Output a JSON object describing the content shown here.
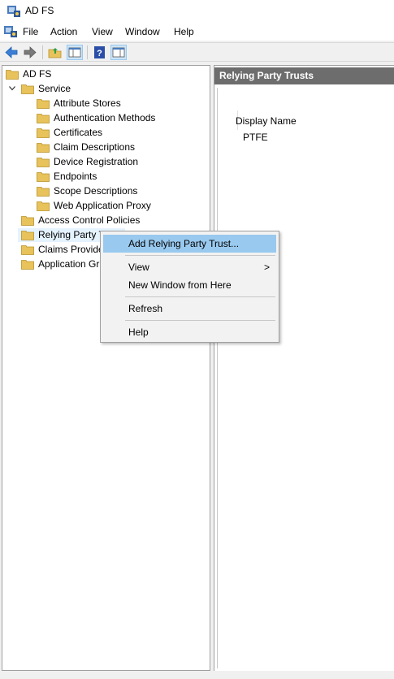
{
  "window": {
    "title": "AD FS"
  },
  "menubar": {
    "items": [
      "File",
      "Action",
      "View",
      "Window",
      "Help"
    ]
  },
  "toolbar": {
    "buttons": [
      "back-icon",
      "forward-icon",
      "up-folder-icon",
      "show-hide-tree-icon",
      "help-icon",
      "show-action-pane-icon"
    ]
  },
  "tree": {
    "root": "AD FS",
    "service": "Service",
    "service_children": [
      "Attribute Stores",
      "Authentication Methods",
      "Certificates",
      "Claim Descriptions",
      "Device Registration",
      "Endpoints",
      "Scope Descriptions",
      "Web Application Proxy"
    ],
    "access_control": "Access Control Policies",
    "relying_party": "Relying Party T",
    "claims_provider": "Claims Provide",
    "application_groups": "Application Gr"
  },
  "right_pane": {
    "header": "Relying Party Trusts",
    "column": "Display Name",
    "rows": [
      "PTFE"
    ]
  },
  "context_menu": {
    "add_relying_party": "Add Relying Party Trust...",
    "view": "View",
    "new_window": "New Window from Here",
    "refresh": "Refresh",
    "help": "Help",
    "submenu_arrow": ">"
  },
  "colors": {
    "menu_highlight": "#99c9ef",
    "header_bg": "#6d6d6d",
    "folder": "#e8c25a"
  }
}
